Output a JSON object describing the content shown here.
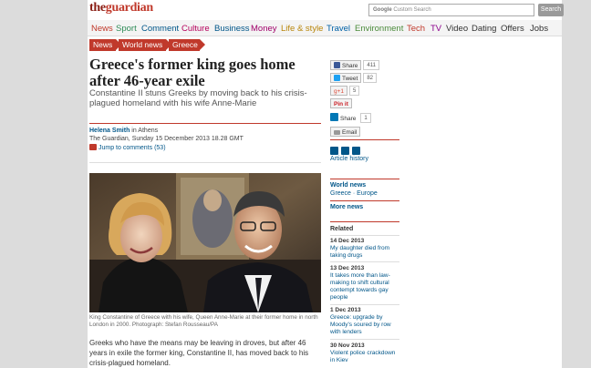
{
  "logo": {
    "the": "the",
    "guardian": "guardian"
  },
  "search": {
    "google_label": "Google",
    "placeholder": "Custom Search",
    "button": "Search"
  },
  "nav": [
    {
      "label": "News",
      "color": "#c0392b"
    },
    {
      "label": "Sport",
      "color": "#2e8b57"
    },
    {
      "label": "Comment",
      "color": "#005689"
    },
    {
      "label": "Culture",
      "color": "#b5005b"
    },
    {
      "label": "Business",
      "color": "#005689"
    },
    {
      "label": "Money",
      "color": "#a0006a"
    },
    {
      "label": "Life & style",
      "color": "#b8860b"
    },
    {
      "label": "Travel",
      "color": "#0061a6"
    },
    {
      "label": "Environment",
      "color": "#4b8b3b"
    },
    {
      "label": "Tech",
      "color": "#c0392b"
    },
    {
      "label": "TV",
      "color": "#8b008b"
    },
    {
      "label": "Video",
      "color": "#333333"
    },
    {
      "label": "Dating",
      "color": "#333333"
    },
    {
      "label": "Offers",
      "color": "#333333"
    },
    {
      "label": "Jobs",
      "color": "#333333"
    }
  ],
  "breadcrumbs": [
    "News",
    "World news",
    "Greece"
  ],
  "article": {
    "headline": "Greece's former king goes home after 46-year exile",
    "standfirst": "Constantine II stuns Greeks by moving back to his crisis-plagued homeland with his wife Anne-Marie",
    "author": "Helena Smith",
    "location": " in Athens",
    "publication_line": "The Guardian, Sunday 15 December 2013 18.28 GMT",
    "comments_link": "Jump to comments (53)",
    "caption": "King Constantine of Greece with his wife, Queen Anne-Marie at their former home in north London in 2000. Photograph: Stefan Rousseau/PA",
    "body": "Greeks who have the means may be leaving in droves, but after 46 years in exile the former king, Constantine II, has moved back to his crisis-plagued homeland."
  },
  "share": {
    "facebook": {
      "label": "Share",
      "count": "411"
    },
    "twitter": {
      "label": "Tweet",
      "count": "82"
    },
    "gplus": {
      "label": "g+1",
      "count": "5"
    },
    "pinterest": {
      "label": "Pin it"
    },
    "linkedin": {
      "label": "Share",
      "count": "1"
    },
    "email": {
      "label": "Email"
    }
  },
  "sidebar": {
    "article_history": "Article history",
    "world_news": "World news",
    "world_news_links": "Greece · Europe",
    "more_news": "More news",
    "related_heading": "Related",
    "related": [
      {
        "date": "14 Dec 2013",
        "title": "My daughter died from taking drugs"
      },
      {
        "date": "13 Dec 2013",
        "title": "It takes more than law-making to shift cultural contempt towards gay people"
      },
      {
        "date": "1 Dec 2013",
        "title": "Greece: upgrade by Moody's soured by row with lenders"
      },
      {
        "date": "30 Nov 2013",
        "title": "Violent police crackdown in Kiev"
      }
    ]
  }
}
